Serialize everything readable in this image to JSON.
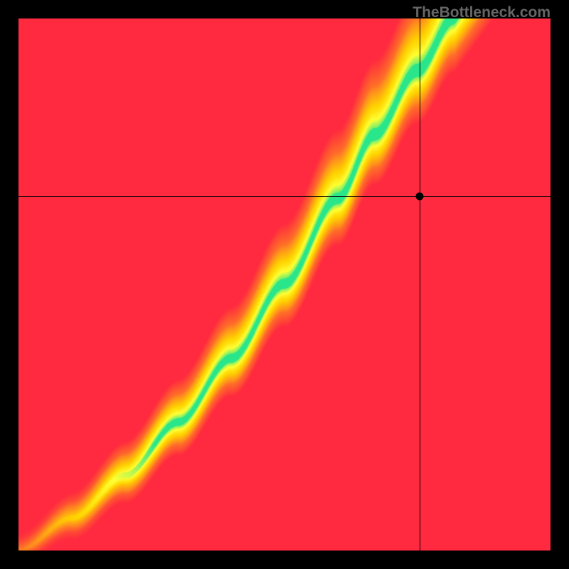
{
  "watermark": "TheBottleneck.com",
  "chart_data": {
    "type": "heatmap",
    "title": "",
    "xlabel": "",
    "ylabel": "",
    "xlim": [
      0,
      1
    ],
    "ylim": [
      0,
      1
    ],
    "ridge": {
      "control_points": [
        {
          "x": 0.0,
          "y": 0.0
        },
        {
          "x": 0.1,
          "y": 0.06
        },
        {
          "x": 0.2,
          "y": 0.14
        },
        {
          "x": 0.3,
          "y": 0.24
        },
        {
          "x": 0.4,
          "y": 0.36
        },
        {
          "x": 0.5,
          "y": 0.5
        },
        {
          "x": 0.6,
          "y": 0.66
        },
        {
          "x": 0.67,
          "y": 0.78
        },
        {
          "x": 0.75,
          "y": 0.9
        },
        {
          "x": 0.82,
          "y": 1.0
        }
      ],
      "description": "green optimal band centroid in normalized coords"
    },
    "crosshair": {
      "x": 0.755,
      "y": 0.665
    },
    "marker": {
      "x": 0.755,
      "y": 0.665
    },
    "colormap": [
      "#ff2a3f",
      "#ff8a1f",
      "#ffd400",
      "#ffff33",
      "#2ae68a"
    ],
    "legend": []
  },
  "colors": {
    "frame": "#000000",
    "watermark": "#666666"
  }
}
